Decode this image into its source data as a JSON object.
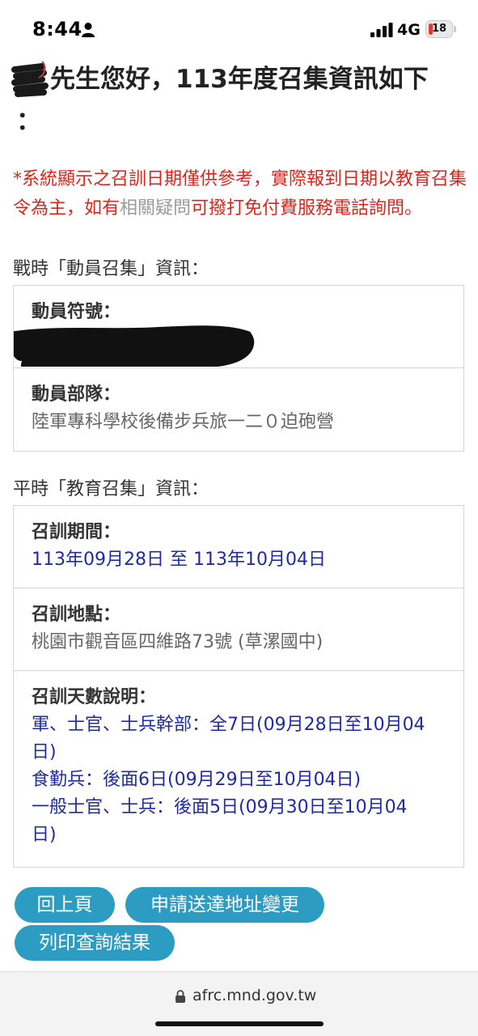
{
  "status_bar": {
    "time": "8:44",
    "network": "4G",
    "battery_level": "18",
    "icons": [
      "person-icon",
      "signal-icon",
      "battery-icon"
    ]
  },
  "heading": {
    "line1": "先生您好，113年度召集資訊如下",
    "line2": "："
  },
  "notice": {
    "part1": "*系統顯示之召訓日期僅供參考，實際報到日期以教育召集令為主，如有",
    "part2": "相關疑問",
    "part3": "可撥打免付費服務電話詢問。"
  },
  "mobilization": {
    "title": "戰時「動員召集」資訊：",
    "symbol_label": "動員符號：",
    "symbol_value": "",
    "unit_label": "動員部隊：",
    "unit_value": "陸軍專科學校後備步兵旅一二０迫砲營"
  },
  "education": {
    "title": "平時「教育召集」資訊：",
    "period_label": "召訓期間：",
    "period_value": "113年09月28日 至 113年10月04日",
    "location_label": "召訓地點：",
    "location_value": "桃園市觀音區四維路73號 (草漯國中)",
    "days_label": "召訓天數說明：",
    "days_items": [
      "軍、士官、士兵幹部：全7日(09月28日至10月04日)",
      "食勤兵：後面6日(09月29日至10月04日)",
      "一般士官、士兵：後面5日(09月30日至10月04日)"
    ]
  },
  "buttons": {
    "back": "回上頁",
    "address_change": "申請送達地址變更",
    "print": "列印查詢結果"
  },
  "browser": {
    "url": "afrc.mnd.gov.tw",
    "icons": [
      "lock-icon"
    ]
  },
  "colors": {
    "notice_red": "#d9261c",
    "value_blue": "#1f2b9e",
    "button_blue": "#2d9cc2"
  }
}
